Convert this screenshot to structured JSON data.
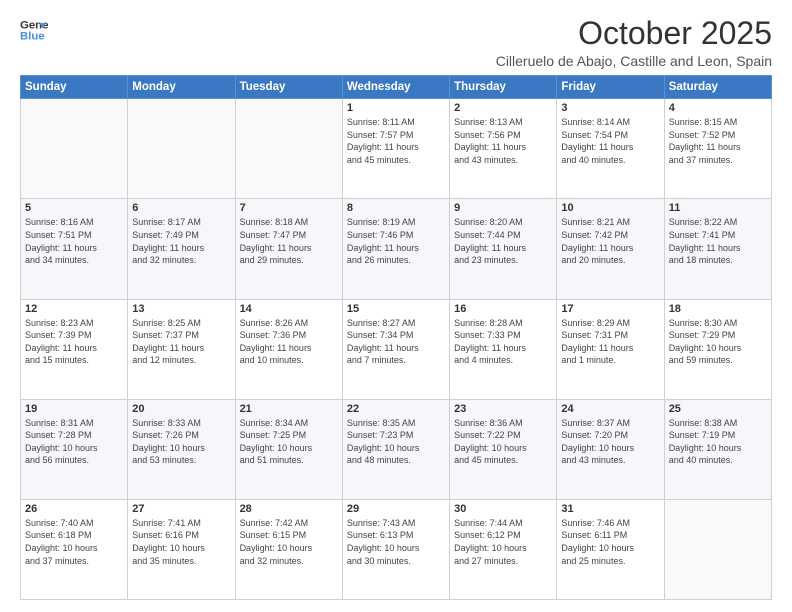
{
  "logo": {
    "line1": "General",
    "line2": "Blue"
  },
  "title": "October 2025",
  "location": "Cilleruelo de Abajo, Castille and Leon, Spain",
  "headers": [
    "Sunday",
    "Monday",
    "Tuesday",
    "Wednesday",
    "Thursday",
    "Friday",
    "Saturday"
  ],
  "weeks": [
    [
      {
        "day": "",
        "info": ""
      },
      {
        "day": "",
        "info": ""
      },
      {
        "day": "",
        "info": ""
      },
      {
        "day": "1",
        "info": "Sunrise: 8:11 AM\nSunset: 7:57 PM\nDaylight: 11 hours\nand 45 minutes."
      },
      {
        "day": "2",
        "info": "Sunrise: 8:13 AM\nSunset: 7:56 PM\nDaylight: 11 hours\nand 43 minutes."
      },
      {
        "day": "3",
        "info": "Sunrise: 8:14 AM\nSunset: 7:54 PM\nDaylight: 11 hours\nand 40 minutes."
      },
      {
        "day": "4",
        "info": "Sunrise: 8:15 AM\nSunset: 7:52 PM\nDaylight: 11 hours\nand 37 minutes."
      }
    ],
    [
      {
        "day": "5",
        "info": "Sunrise: 8:16 AM\nSunset: 7:51 PM\nDaylight: 11 hours\nand 34 minutes."
      },
      {
        "day": "6",
        "info": "Sunrise: 8:17 AM\nSunset: 7:49 PM\nDaylight: 11 hours\nand 32 minutes."
      },
      {
        "day": "7",
        "info": "Sunrise: 8:18 AM\nSunset: 7:47 PM\nDaylight: 11 hours\nand 29 minutes."
      },
      {
        "day": "8",
        "info": "Sunrise: 8:19 AM\nSunset: 7:46 PM\nDaylight: 11 hours\nand 26 minutes."
      },
      {
        "day": "9",
        "info": "Sunrise: 8:20 AM\nSunset: 7:44 PM\nDaylight: 11 hours\nand 23 minutes."
      },
      {
        "day": "10",
        "info": "Sunrise: 8:21 AM\nSunset: 7:42 PM\nDaylight: 11 hours\nand 20 minutes."
      },
      {
        "day": "11",
        "info": "Sunrise: 8:22 AM\nSunset: 7:41 PM\nDaylight: 11 hours\nand 18 minutes."
      }
    ],
    [
      {
        "day": "12",
        "info": "Sunrise: 8:23 AM\nSunset: 7:39 PM\nDaylight: 11 hours\nand 15 minutes."
      },
      {
        "day": "13",
        "info": "Sunrise: 8:25 AM\nSunset: 7:37 PM\nDaylight: 11 hours\nand 12 minutes."
      },
      {
        "day": "14",
        "info": "Sunrise: 8:26 AM\nSunset: 7:36 PM\nDaylight: 11 hours\nand 10 minutes."
      },
      {
        "day": "15",
        "info": "Sunrise: 8:27 AM\nSunset: 7:34 PM\nDaylight: 11 hours\nand 7 minutes."
      },
      {
        "day": "16",
        "info": "Sunrise: 8:28 AM\nSunset: 7:33 PM\nDaylight: 11 hours\nand 4 minutes."
      },
      {
        "day": "17",
        "info": "Sunrise: 8:29 AM\nSunset: 7:31 PM\nDaylight: 11 hours\nand 1 minute."
      },
      {
        "day": "18",
        "info": "Sunrise: 8:30 AM\nSunset: 7:29 PM\nDaylight: 10 hours\nand 59 minutes."
      }
    ],
    [
      {
        "day": "19",
        "info": "Sunrise: 8:31 AM\nSunset: 7:28 PM\nDaylight: 10 hours\nand 56 minutes."
      },
      {
        "day": "20",
        "info": "Sunrise: 8:33 AM\nSunset: 7:26 PM\nDaylight: 10 hours\nand 53 minutes."
      },
      {
        "day": "21",
        "info": "Sunrise: 8:34 AM\nSunset: 7:25 PM\nDaylight: 10 hours\nand 51 minutes."
      },
      {
        "day": "22",
        "info": "Sunrise: 8:35 AM\nSunset: 7:23 PM\nDaylight: 10 hours\nand 48 minutes."
      },
      {
        "day": "23",
        "info": "Sunrise: 8:36 AM\nSunset: 7:22 PM\nDaylight: 10 hours\nand 45 minutes."
      },
      {
        "day": "24",
        "info": "Sunrise: 8:37 AM\nSunset: 7:20 PM\nDaylight: 10 hours\nand 43 minutes."
      },
      {
        "day": "25",
        "info": "Sunrise: 8:38 AM\nSunset: 7:19 PM\nDaylight: 10 hours\nand 40 minutes."
      }
    ],
    [
      {
        "day": "26",
        "info": "Sunrise: 7:40 AM\nSunset: 6:18 PM\nDaylight: 10 hours\nand 37 minutes."
      },
      {
        "day": "27",
        "info": "Sunrise: 7:41 AM\nSunset: 6:16 PM\nDaylight: 10 hours\nand 35 minutes."
      },
      {
        "day": "28",
        "info": "Sunrise: 7:42 AM\nSunset: 6:15 PM\nDaylight: 10 hours\nand 32 minutes."
      },
      {
        "day": "29",
        "info": "Sunrise: 7:43 AM\nSunset: 6:13 PM\nDaylight: 10 hours\nand 30 minutes."
      },
      {
        "day": "30",
        "info": "Sunrise: 7:44 AM\nSunset: 6:12 PM\nDaylight: 10 hours\nand 27 minutes."
      },
      {
        "day": "31",
        "info": "Sunrise: 7:46 AM\nSunset: 6:11 PM\nDaylight: 10 hours\nand 25 minutes."
      },
      {
        "day": "",
        "info": ""
      }
    ]
  ]
}
